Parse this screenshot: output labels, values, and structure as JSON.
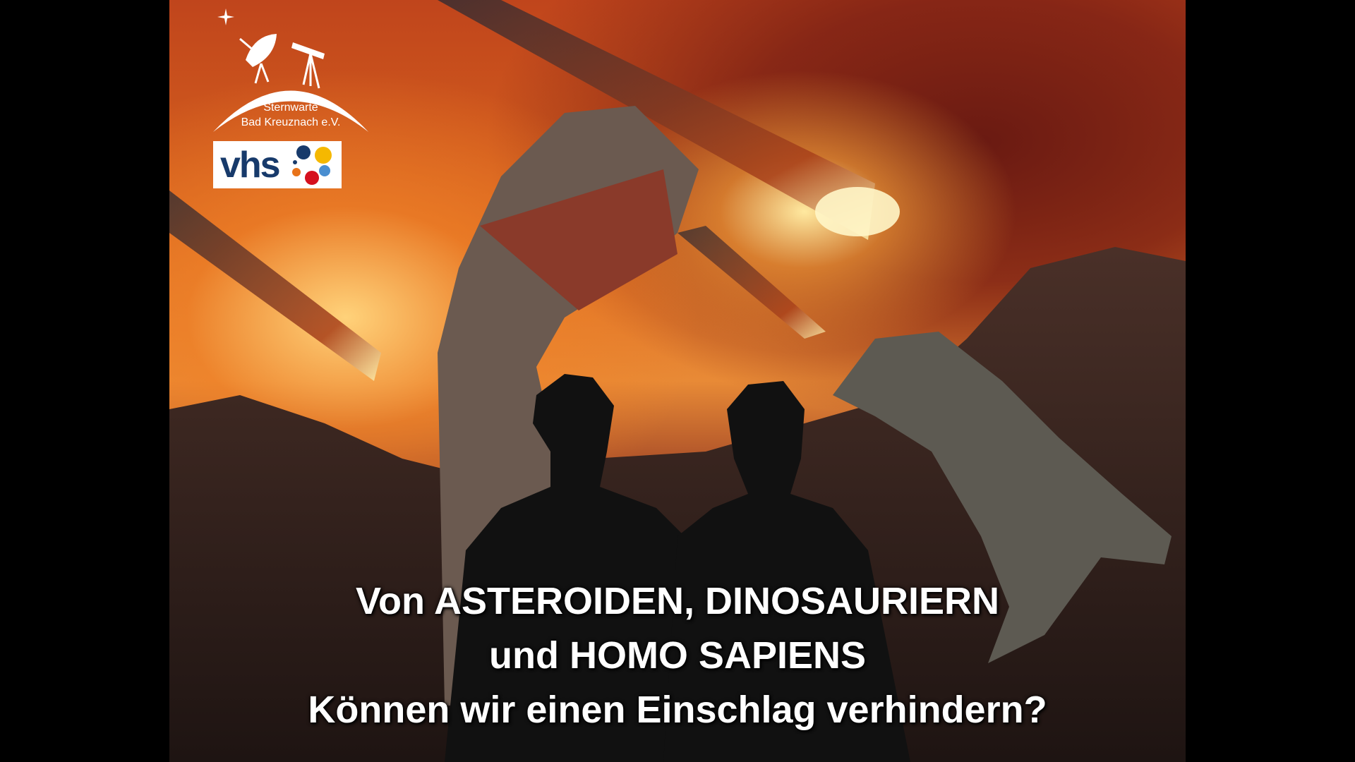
{
  "logo": {
    "line1": "Sternwarte",
    "line2": "Bad Kreuznach e.V.",
    "vhs": "vhs"
  },
  "title": {
    "line1": "Von ASTEROIDEN, DINOSAURIERN",
    "line2": "und HOMO SAPIENS",
    "line3": "Können wir einen Einschlag verhindern?"
  }
}
